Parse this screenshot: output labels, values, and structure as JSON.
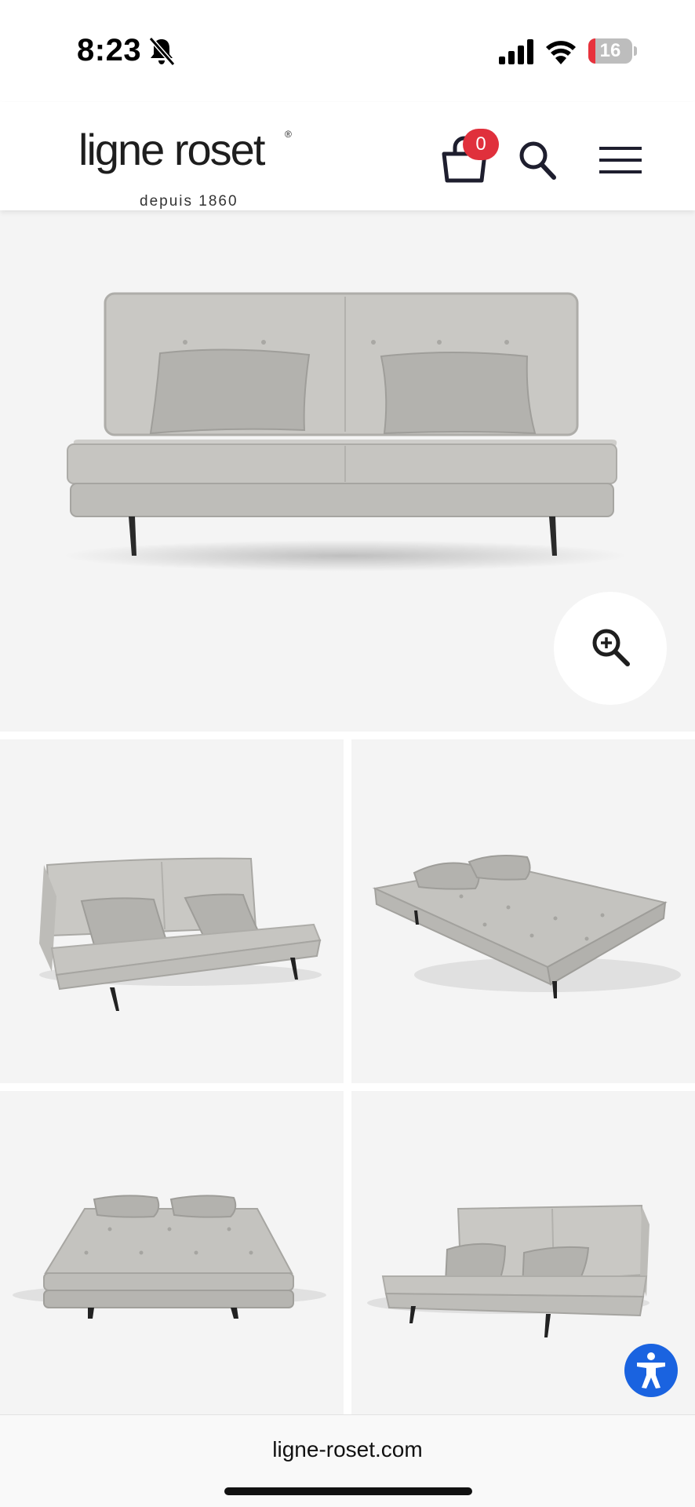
{
  "status_bar": {
    "time": "8:23",
    "battery_level": "16",
    "battery_fraction": 0.16,
    "icons": [
      "bell-slash-icon",
      "cellular-signal-icon",
      "wifi-icon",
      "battery-icon"
    ]
  },
  "header": {
    "logo_text": "ligne roset",
    "logo_registered": "®",
    "logo_tagline": "depuis 1860",
    "cart_count": "0",
    "icons": [
      "cart-icon",
      "search-icon",
      "hamburger-menu-icon"
    ],
    "colors": {
      "badge": "#e0303c",
      "icon": "#1e1e2e"
    }
  },
  "gallery": {
    "main_image": "sofa-front-view",
    "zoom_icon": "zoom-in-icon",
    "thumbnails": [
      "sofa-angled-left-view",
      "sofa-bed-angled-view",
      "sofa-bed-front-view",
      "sofa-angled-right-view"
    ],
    "background": "#f4f4f4"
  },
  "accessibility": {
    "icon": "accessibility-icon",
    "color": "#1a63e0"
  },
  "browser": {
    "url": "ligne-roset.com"
  }
}
